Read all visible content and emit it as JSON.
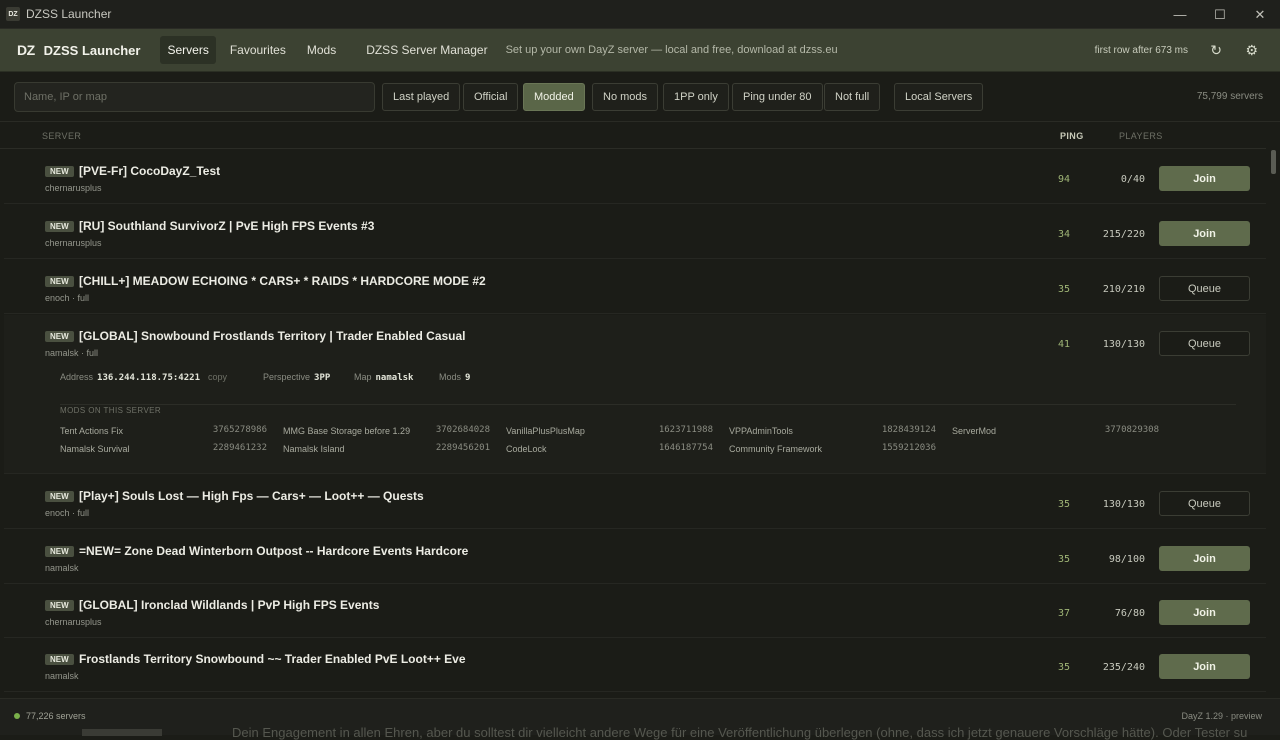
{
  "window": {
    "title": "DZSS Launcher",
    "icon_text": "DZ"
  },
  "header": {
    "logo": "DZ",
    "brand": "DZSS Launcher",
    "nav": [
      "Servers",
      "Favourites",
      "Mods"
    ],
    "manager": "DZSS Server Manager",
    "tagline": "Set up your own DayZ server — local and free, download at dzss.eu",
    "first_row": "first row after 673 ms"
  },
  "filters": {
    "search_placeholder": "Name, IP or map",
    "chips": [
      "Last played",
      "Official",
      "Modded",
      "No mods",
      "1PP only",
      "Ping under 80",
      "Not full",
      "Local Servers"
    ],
    "active_chip": "Modded",
    "server_count": "75,799 servers"
  },
  "columns": {
    "server": "SERVER",
    "ping": "PING",
    "players": "PLAYERS"
  },
  "badge_label": "NEW",
  "rows": [
    {
      "name": "[PVE-Fr] CocoDayZ_Test",
      "sub": "chernarusplus",
      "ping": "94",
      "players": "0/40",
      "action": "Join"
    },
    {
      "name": "[RU] Southland SurvivorZ | PvE High FPS Events #3",
      "sub": "chernarusplus",
      "ping": "34",
      "players": "215/220",
      "action": "Join"
    },
    {
      "name": "[CHILL+] MEADOW ECHOING * CARS+ * RAIDS * HARDCORE MODE #2",
      "sub": "enoch · full",
      "ping": "35",
      "players": "210/210",
      "action": "Queue"
    },
    {
      "name": "[GLOBAL] Snowbound Frostlands Territory | Trader Enabled Casual",
      "sub": "namalsk · full",
      "ping": "41",
      "players": "130/130",
      "action": "Queue"
    },
    {
      "name": "[Play+] Souls Lost — High Fps — Cars+ — Loot++ — Quests",
      "sub": "enoch · full",
      "ping": "35",
      "players": "130/130",
      "action": "Queue"
    },
    {
      "name": "=NEW= Zone Dead Winterborn Outpost -- Hardcore Events Hardcore",
      "sub": "namalsk",
      "ping": "35",
      "players": "98/100",
      "action": "Join"
    },
    {
      "name": "[GLOBAL] Ironclad Wildlands | PvP High FPS Events",
      "sub": "chernarusplus",
      "ping": "37",
      "players": "76/80",
      "action": "Join"
    },
    {
      "name": "Frostlands Territory Snowbound ~~ Trader Enabled PvE Loot++ Eve",
      "sub": "namalsk",
      "ping": "35",
      "players": "235/240",
      "action": "Join"
    }
  ],
  "details": {
    "address_label": "Address",
    "address": "136.244.118.75:4221",
    "copy": "copy",
    "perspective_label": "Perspective",
    "perspective": "3PP",
    "map_label": "Map",
    "map": "namalsk",
    "mods_label": "Mods",
    "mods_count": "9",
    "mods_title": "MODS ON THIS SERVER",
    "mods": [
      {
        "name": "Tent Actions Fix",
        "id": "3765278986"
      },
      {
        "name": "MMG Base Storage before 1.29",
        "id": "3702684028"
      },
      {
        "name": "VanillaPlusPlusMap",
        "id": "1623711988"
      },
      {
        "name": "VPPAdminTools",
        "id": "1828439124"
      },
      {
        "name": "ServerMod",
        "id": "3770829308"
      },
      {
        "name": "Namalsk Survival",
        "id": "2289461232"
      },
      {
        "name": "Namalsk Island",
        "id": "2289456201"
      },
      {
        "name": "CodeLock",
        "id": "1646187754"
      },
      {
        "name": "Community Framework",
        "id": "1559212036"
      }
    ]
  },
  "footer": {
    "count": "77,226 servers",
    "version": "DayZ 1.29 · preview",
    "background_text": "Dein Engagement in allen Ehren, aber du solltest dir vielleicht andere Wege für eine Veröffentlichung überlegen (ohne, dass ich jetzt genauere Vorschläge hätte). Oder Tester su"
  }
}
